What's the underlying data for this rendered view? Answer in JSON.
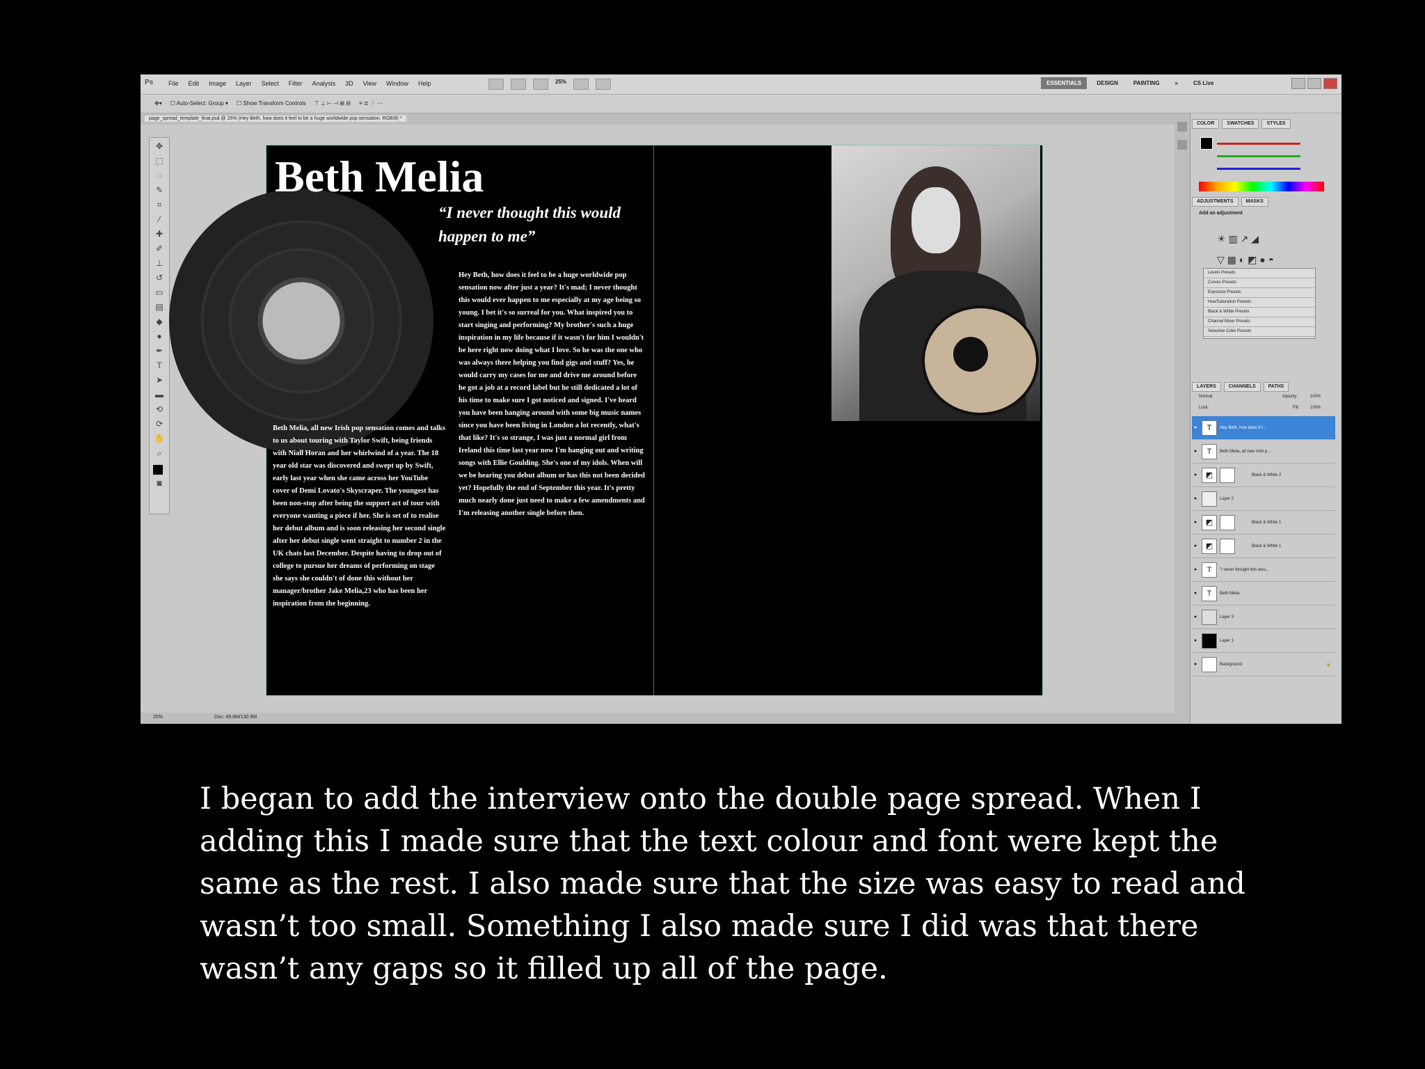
{
  "app": {
    "menus": [
      "File",
      "Edit",
      "Image",
      "Layer",
      "Select",
      "Filter",
      "Analysis",
      "3D",
      "View",
      "Window",
      "Help"
    ],
    "zoom": "25%",
    "workspaces": [
      "ESSENTIALS",
      "DESIGN",
      "PAINTING"
    ],
    "cs_live": "CS Live",
    "document_tab": "page_spread_template_final.psd @ 25% (Hey Beth, how does it feel to be a huge worldwide pop sensation, RGB/8) *",
    "status_zoom": "25%",
    "status_doc": "Doc: 49.8M/130.9M"
  },
  "spread": {
    "title": "Beth Melia",
    "quote": "“I never thought this would happen to me”",
    "intro_text": "Beth Melia, all new Irish pop sensation comes and talks to us about touring with Taylor Swift, being friends with Niall Horan and her whirlwind of a year. The 18 year old star was discovered and swept up by Swift, early last year when she came across her YouTube cover of Demi Lovato's Skyscraper. The youngest has been non-stop after being the support act of tour with everyone wanting a piece if her. She is set of to realise her debut album and is soon releasing her second single after her debut single went straight to number 2 in the UK chats last December. Despite having to drop out of college to pursue her dreams of performing on stage she says she couldn't of done this without her manager/brother Jake Melia,23 who has been her inspiration from the beginning.",
    "interview_text": "Hey Beth, how does it feel to be a huge worldwide pop sensation now after just a year? It's mad; I never thought this would ever happen to me especially at my age being so young. I bet it's so surreal for you. What inspired you to start singing and performing? My brother's such a huge inspiration in my life because if it wasn't for him I wouldn't be here right now doing what I love. So he was the one who was always there helping you find gigs and stuff? Yes, he would carry my cases for me and drive me around before he got a job at a record label but he still dedicated a lot of his time to make sure I got noticed and signed. I've heard you have been hanging around with some big music names since you have been living in London a lot recently, what's that like? It's so strange, I was just a normal girl from Ireland this time last year now I'm hanging out and writing songs with Ellie Goulding. She's one of my idols. When will we be hearing you debut album or has this not been decided yet? Hopefully the end of September this year. It's pretty much nearly done just need to make a few amendments and I'm releasing another single before then."
  },
  "panels": {
    "color_tabs": [
      "COLOR",
      "SWATCHES",
      "STYLES"
    ],
    "adjustments_tabs": [
      "ADJUSTMENTS",
      "MASKS"
    ],
    "adjustments_title": "Add an adjustment",
    "presets": [
      "Levels Presets",
      "Curves Presets",
      "Exposure Presets",
      "Hue/Saturation Presets",
      "Black & White Presets",
      "Channel Mixer Presets",
      "Selective Color Presets"
    ],
    "layers_tabs": [
      "LAYERS",
      "CHANNELS",
      "PATHS"
    ],
    "blend_mode": "Normal",
    "opacity_label": "Opacity:",
    "opacity": "100%",
    "fill_label": "Fill:",
    "fill": "100%",
    "lock_label": "Lock:",
    "layers": [
      {
        "type": "text",
        "name": "Hey Beth, how does it f..."
      },
      {
        "type": "text",
        "name": "Beth Melia, all new Irish p..."
      },
      {
        "type": "adjust",
        "name": "Black & White 2"
      },
      {
        "type": "pixel",
        "name": "Layer 2"
      },
      {
        "type": "adjust",
        "name": "Black & White 1"
      },
      {
        "type": "adjust",
        "name": "Black & White 1"
      },
      {
        "type": "text",
        "name": "\"I never thought this wou..."
      },
      {
        "type": "text",
        "name": "Beth Melia"
      },
      {
        "type": "pixel",
        "name": "Layer 3"
      },
      {
        "type": "black",
        "name": "Layer 1"
      },
      {
        "type": "pixel",
        "name": "Background"
      }
    ]
  },
  "caption": {
    "lines": [
      "I began to add the interview onto the double page spread. When I",
      "adding this I made sure that the text colour and font were kept the",
      "same as the rest. I also made sure that the size was easy to read and",
      "wasn’t too small. Something I also made sure I did was that there",
      "wasn’t any gaps so it filled up all of the page."
    ]
  },
  "colors": {
    "selected_layer": "#3b84d8",
    "guide": "#7fc4c4"
  }
}
